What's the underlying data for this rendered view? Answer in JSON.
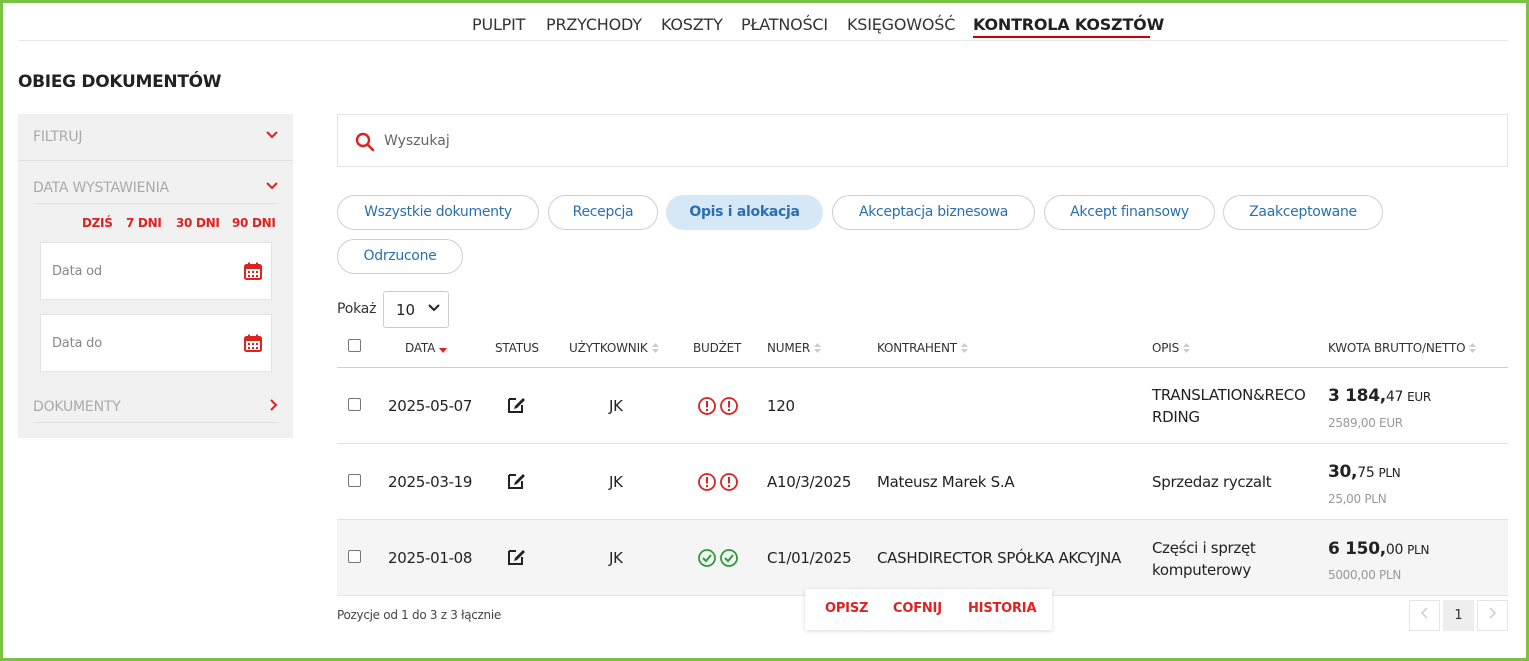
{
  "nav": {
    "items": [
      {
        "label": "PULPIT"
      },
      {
        "label": "PRZYCHODY"
      },
      {
        "label": "KOSZTY"
      },
      {
        "label": "PŁATNOŚCI"
      },
      {
        "label": "KSIĘGOWOŚĆ"
      },
      {
        "label": "KONTROLA KOSZTÓW",
        "active": true
      }
    ]
  },
  "page_title": "OBIEG DOKUMENTÓW",
  "sidebar": {
    "filter_label": "FILTRUJ",
    "date_label": "DATA WYSTAWIENIA",
    "quick": [
      "DZIŚ",
      "7 DNI",
      "30 DNI",
      "90 DNI"
    ],
    "date_from_placeholder": "Data od",
    "date_to_placeholder": "Data do",
    "documents_label": "DOKUMENTY"
  },
  "search": {
    "placeholder": "Wyszukaj"
  },
  "pills": [
    {
      "label": "Wszystkie dokumenty"
    },
    {
      "label": "Recepcja"
    },
    {
      "label": "Opis i alokacja",
      "active": true
    },
    {
      "label": "Akceptacja biznesowa"
    },
    {
      "label": "Akcept finansowy"
    },
    {
      "label": "Zaakceptowane"
    },
    {
      "label": "Odrzucone"
    }
  ],
  "show": {
    "label": "Pokaż",
    "value": "10"
  },
  "table": {
    "headers": {
      "date": "DATA",
      "status": "STATUS",
      "user": "UŻYTKOWNIK",
      "budget": "BUDŻET",
      "number": "NUMER",
      "contractor": "KONTRAHENT",
      "desc": "OPIS",
      "amount": "KWOTA BRUTTO/NETTO"
    },
    "rows": [
      {
        "date": "2025-05-07",
        "status": "edit-icon",
        "user": "JK",
        "budget": "warning",
        "number": "120",
        "contractor": "",
        "desc": "TRANSLATION&RECO RDING",
        "amount_int": "3 184,",
        "amount_dec": "47",
        "currency": "EUR",
        "net": "2589,00 EUR"
      },
      {
        "date": "2025-03-19",
        "status": "edit-icon",
        "user": "JK",
        "budget": "warning",
        "number": "A10/3/2025",
        "contractor": "Mateusz Marek S.A",
        "desc": "Sprzedaz ryczalt",
        "amount_int": "30,",
        "amount_dec": "75",
        "currency": "PLN",
        "net": "25,00 PLN"
      },
      {
        "date": "2025-01-08",
        "status": "edit-icon",
        "user": "JK",
        "budget": "ok",
        "number": "C1/01/2025",
        "contractor": "CASHDIRECTOR SPÓŁKA AKCYJNA",
        "desc": "Części i sprzęt komputerowy",
        "amount_int": "6 150,",
        "amount_dec": "00",
        "currency": "PLN",
        "net": "5000,00 PLN"
      }
    ]
  },
  "summary": "Pozycje od 1 do 3 z 3 łącznie",
  "actions": {
    "describe": "OPISZ",
    "undo": "COFNIJ",
    "history": "HISTORIA"
  },
  "pagination": {
    "current": "1"
  },
  "colors": {
    "accent": "#d22222",
    "link": "#2a6fb0",
    "active_pill": "#d6e7f6",
    "ok": "#2a9d3a",
    "frame": "#7cc242"
  }
}
